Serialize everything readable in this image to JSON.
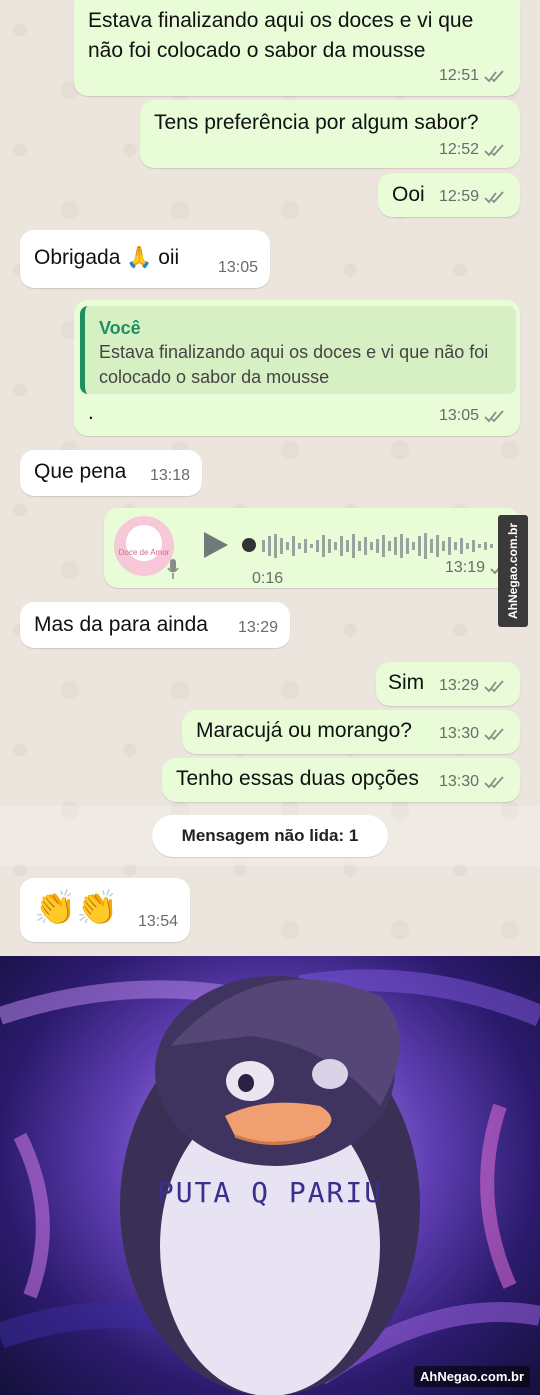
{
  "messages": [
    {
      "text": "Estava finalizando aqui os doces e vi que\nnão foi colocado o sabor da mousse",
      "time": "12:51"
    },
    {
      "text": "Tens preferência por algum sabor?",
      "time": "12:52"
    },
    {
      "text": "Ooi",
      "time": "12:59"
    },
    {
      "text": "Obrigada 🙏 oii",
      "time": "13:05"
    },
    {
      "reply_author": "Você",
      "reply_text": "Estava finalizando aqui os doces e vi que não foi colocado o sabor da mousse",
      "text": ".",
      "time": "13:05"
    },
    {
      "text": "Que pena",
      "time": "13:18"
    },
    {
      "audio_duration": "0:16",
      "time": "13:19",
      "thumb_label": "Doce de Amor"
    },
    {
      "text": "Mas da para ainda",
      "time": "13:29"
    },
    {
      "text": "Sim",
      "time": "13:29"
    },
    {
      "text": "Maracujá ou morango?",
      "time": "13:30"
    },
    {
      "text": "Tenho essas duas opções",
      "time": "13:30"
    },
    {
      "text": "👏👏",
      "time": "13:54"
    }
  ],
  "unread_divider": "Mensagem não lida: 1",
  "watermark_side": "AhNegao.com.br",
  "meme": {
    "caption": "PUTA  Q  PARIU",
    "watermark": "AhNegao.com.br"
  },
  "colors": {
    "outgoing_bubble": "#e7fcd7",
    "incoming_bubble": "#ffffff",
    "chat_background": "#ece5dd",
    "tick": "#8a8a8a",
    "quote_accent": "#1f8f5f"
  }
}
